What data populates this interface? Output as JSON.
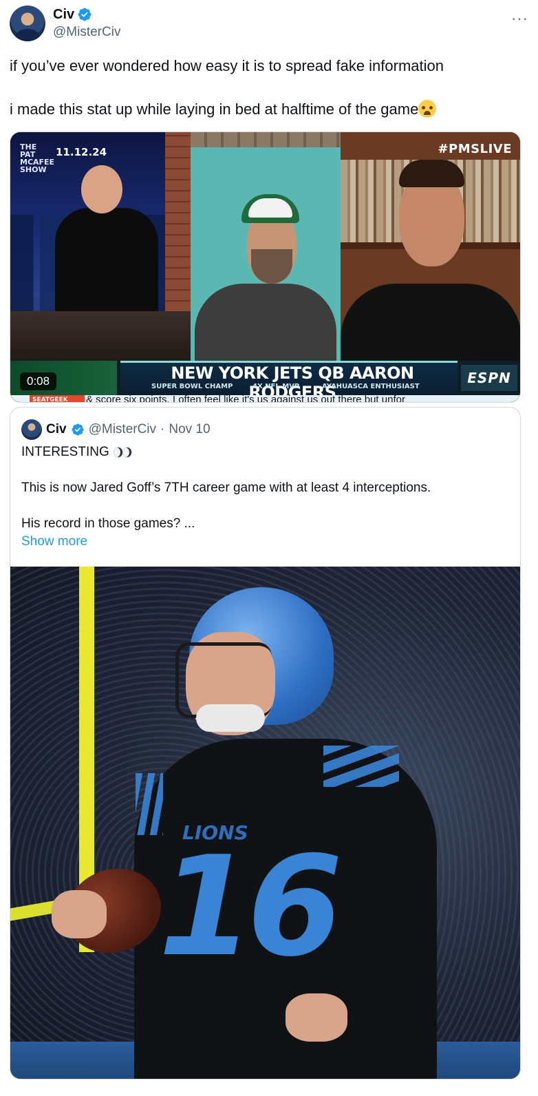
{
  "author": {
    "name": "Civ",
    "handle": "@MisterCiv"
  },
  "tweet": {
    "line1": "if you’ve ever wondered how easy it is to spread fake information",
    "line2": "i made this stat up while laying in bed at halftime of the game"
  },
  "video": {
    "show_logo": "THE PAT MCAFEE SHOW",
    "date": "11.12.24",
    "hashtag": "#PMSLIVE",
    "lower_third_title": "NEW YORK JETS QB AARON RODGERS",
    "subtitle_1": "SUPER BOWL CHAMP",
    "subtitle_2": "4X NFL MVP",
    "subtitle_3": "AYAHUASCA ENTHUSIAST",
    "network": "ESPN",
    "ticker_sponsor": "SEATGEEK",
    "ticker_text": "& score six points. I often feel like it's us against us out there but unfor",
    "timestamp": "0:08"
  },
  "quote": {
    "name": "Civ",
    "handle": "@MisterCiv",
    "separator": "·",
    "date": "Nov 10",
    "line1": "INTERESTING",
    "line2": "This is now Jared Goff’s 7TH career game with at least 4 interceptions.",
    "line3": "His record in those games? ...",
    "show_more": "Show more",
    "photo": {
      "team_wordmark": "LIONS",
      "jersey_number": "16"
    }
  },
  "colors": {
    "text_primary": "#0f1419",
    "text_secondary": "#536471",
    "link": "#1d9bf0",
    "verified": "#1d9bf0",
    "border": "#cfd9de"
  },
  "icons": {
    "verified": "verified-badge-icon",
    "more": "more-options-icon",
    "emoji_tweet": "loudly-crying-face-emoji",
    "emoji_quote": "eyes-emoji"
  }
}
